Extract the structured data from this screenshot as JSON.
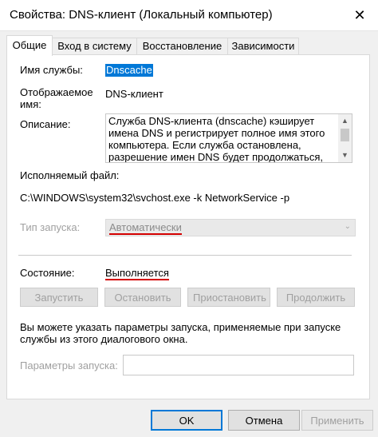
{
  "window": {
    "title": "Свойства: DNS-клиент (Локальный компьютер)",
    "close_glyph": "✕"
  },
  "tabs": [
    {
      "label": "Общие",
      "active": true
    },
    {
      "label": "Вход в систему",
      "active": false
    },
    {
      "label": "Восстановление",
      "active": false
    },
    {
      "label": "Зависимости",
      "active": false
    }
  ],
  "general": {
    "service_name_label": "Имя службы:",
    "service_name_value": "Dnscache",
    "display_name_label_line1": "Отображаемое",
    "display_name_label_line2": "имя:",
    "display_name_value": "DNS-клиент",
    "description_label": "Описание:",
    "description_lines": [
      "Служба DNS-клиента (dnscache) кэширует",
      "имена DNS и регистрирует полное имя этого",
      "компьютера. Если служба остановлена,",
      "разрешение имен DNS будет продолжаться, но"
    ],
    "exe_label": "Исполняемый файл:",
    "exe_path": "C:\\WINDOWS\\system32\\svchost.exe -k NetworkService -p",
    "startup_type_label": "Тип запуска:",
    "startup_type_value": "Автоматически",
    "status_label": "Состояние:",
    "status_value": "Выполняется",
    "buttons": {
      "start": "Запустить",
      "stop": "Остановить",
      "pause": "Приостановить",
      "resume": "Продолжить"
    },
    "hint_line1": "Вы можете указать параметры запуска, применяемые при запуске",
    "hint_line2": "службы из этого диалогового окна.",
    "params_label": "Параметры запуска:",
    "params_value": ""
  },
  "dialog_buttons": {
    "ok": "OK",
    "cancel": "Отмена",
    "apply": "Применить"
  },
  "colors": {
    "accent": "#0078d7",
    "annotation_underline": "#d40000"
  }
}
